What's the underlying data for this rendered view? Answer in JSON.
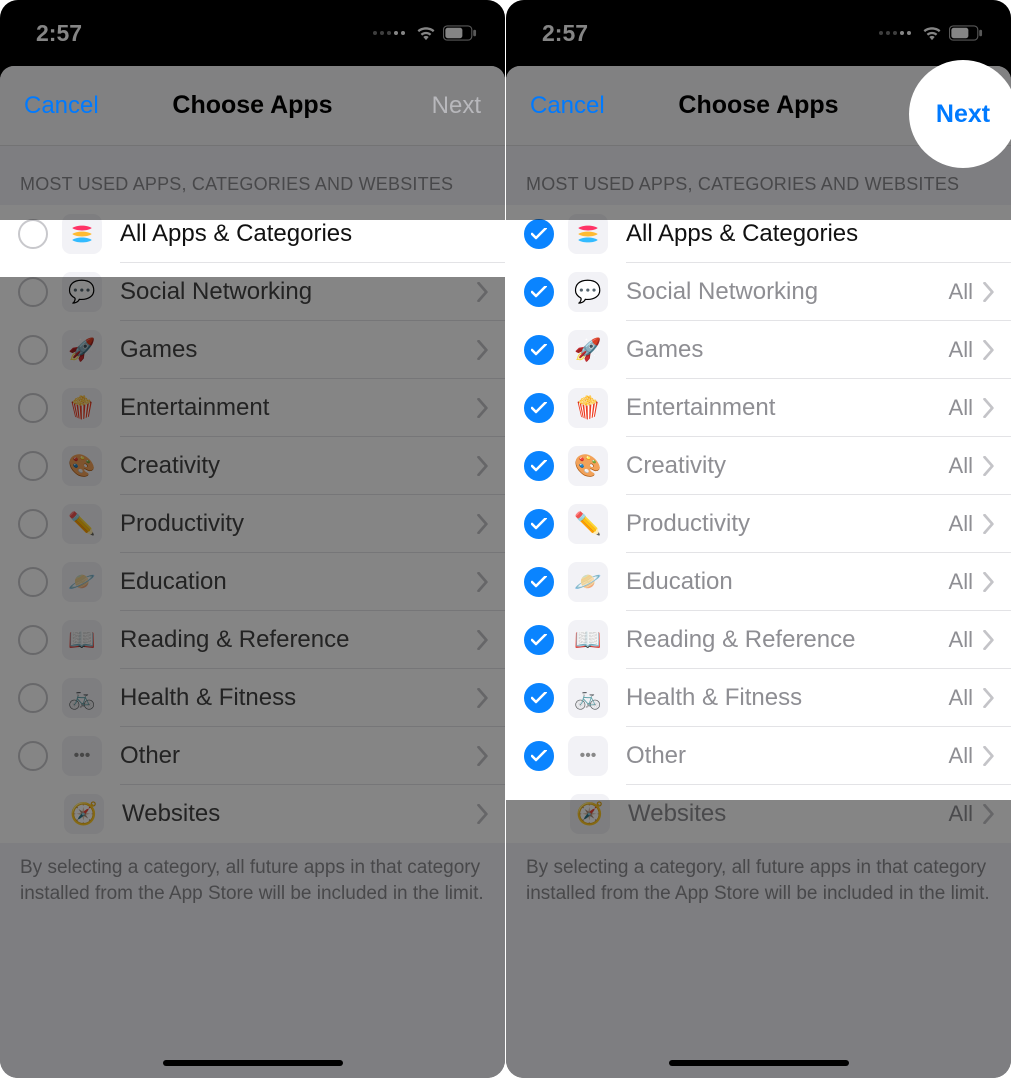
{
  "status": {
    "time": "2:57"
  },
  "nav": {
    "cancel": "Cancel",
    "title": "Choose Apps",
    "next": "Next"
  },
  "section_header": "MOST USED APPS, CATEGORIES AND WEBSITES",
  "all_label": "All Apps & Categories",
  "detail_all": "All",
  "categories": [
    {
      "id": "social",
      "label": "Social Networking",
      "emoji": "💬"
    },
    {
      "id": "games",
      "label": "Games",
      "emoji": "🚀"
    },
    {
      "id": "entertainment",
      "label": "Entertainment",
      "emoji": "🍿"
    },
    {
      "id": "creativity",
      "label": "Creativity",
      "emoji": "🎨"
    },
    {
      "id": "productivity",
      "label": "Productivity",
      "emoji": "✏️"
    },
    {
      "id": "education",
      "label": "Education",
      "emoji": "🪐"
    },
    {
      "id": "reading",
      "label": "Reading & Reference",
      "emoji": "📖"
    },
    {
      "id": "health",
      "label": "Health & Fitness",
      "emoji": "🚲"
    },
    {
      "id": "other",
      "label": "Other",
      "emoji": "•••"
    }
  ],
  "websites": {
    "label": "Websites",
    "emoji": "🧭"
  },
  "footer": "By selecting a category, all future apps in that category installed from the App Store will be included in the limit.",
  "left_state": {
    "checked": false,
    "next_enabled": false,
    "show_detail": false
  },
  "right_state": {
    "checked": true,
    "next_enabled": true,
    "show_detail": true
  }
}
